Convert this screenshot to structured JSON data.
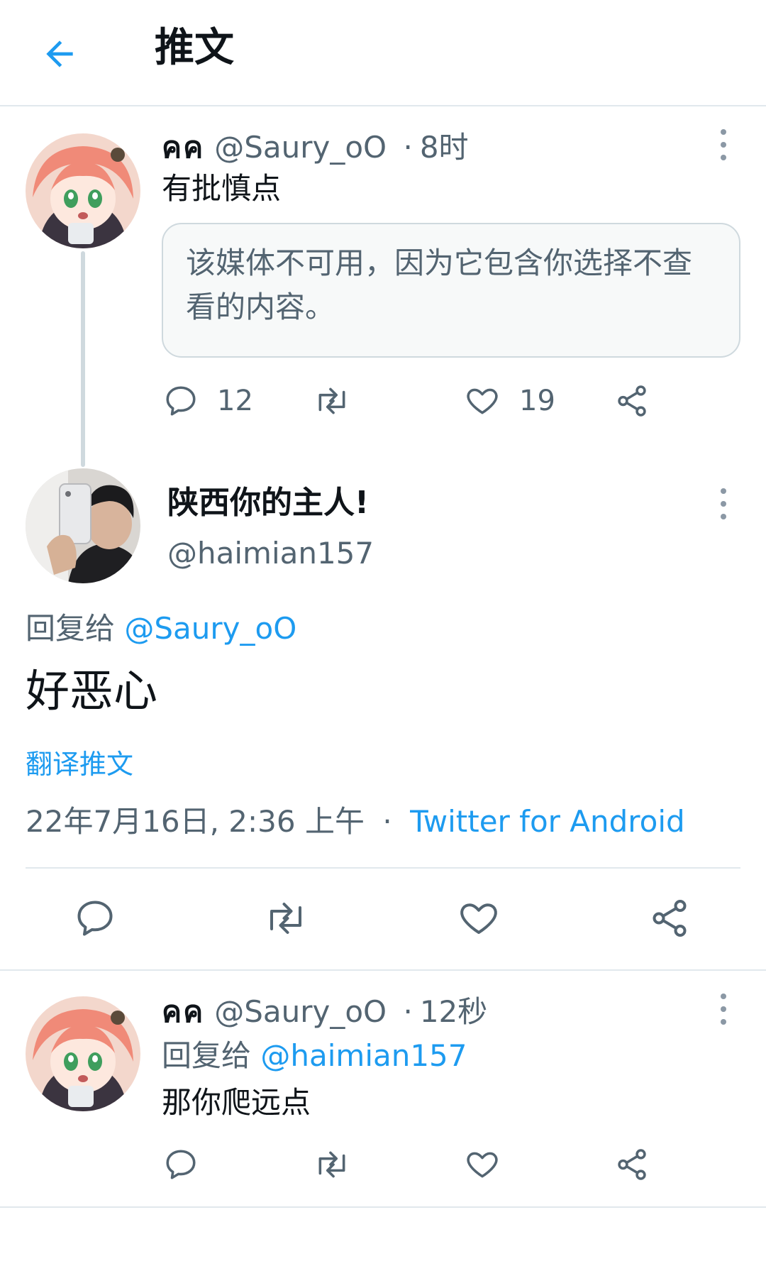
{
  "header": {
    "title": "推文"
  },
  "parent_tweet": {
    "display_name": "คค",
    "handle": "@Saury_oO",
    "separator": "·",
    "time": "8时",
    "text": "有批慎点",
    "media_notice": "该媒体不可用，因为它包含你选择不查看的内容。",
    "actions": {
      "reply_count": "12",
      "retweet_count": "",
      "like_count": "19"
    }
  },
  "main_tweet": {
    "display_name": "陕西你的主人!",
    "handle": "@haimian157",
    "reply_prefix": "回复给",
    "reply_to": "@Saury_oO",
    "text": "好恶心",
    "translate": "翻译推文",
    "datetime": "22年7月16日, 2:36 上午",
    "separator": "·",
    "source": "Twitter for Android"
  },
  "reply_tweet": {
    "display_name": "คค",
    "handle": "@Saury_oO",
    "separator": "·",
    "time": "12秒",
    "reply_prefix": "回复给",
    "reply_to": "@haimian157",
    "text": "那你爬远点"
  },
  "icons": {
    "back": "arrow-left-icon",
    "more": "more-vertical-icon",
    "reply": "reply-icon",
    "retweet": "retweet-icon",
    "like": "heart-icon",
    "share": "share-icon"
  },
  "colors": {
    "accent": "#1d9bf0",
    "muted": "#536471",
    "divider": "#e1e8ed"
  }
}
